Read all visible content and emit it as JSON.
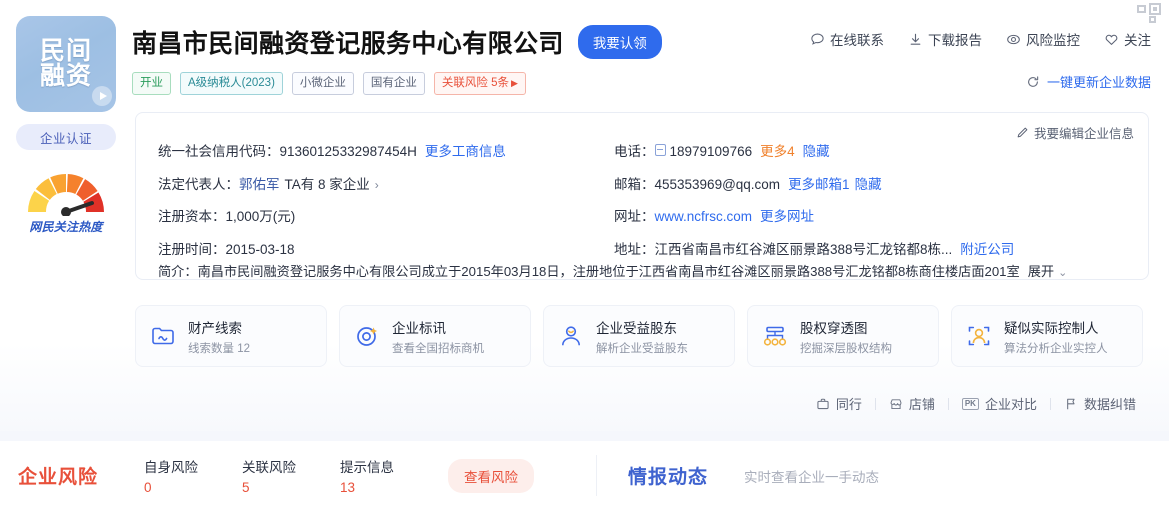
{
  "sidebar": {
    "logo_text_line1": "民间",
    "logo_text_line2": "融资",
    "play_icon": "play-icon",
    "cert_label": "企业认证",
    "gauge_label": "网民关注热度"
  },
  "header": {
    "company_name": "南昌市民间融资登记服务中心有限公司",
    "claim_button": "我要认领",
    "tags": [
      {
        "label": "开业",
        "style": "green"
      },
      {
        "label": "A级纳税人(2023)",
        "style": "teal"
      },
      {
        "label": "小微企业",
        "style": "grey"
      },
      {
        "label": "国有企业",
        "style": "grey"
      },
      {
        "label": "关联风险 5条",
        "style": "red",
        "arrow": "▶"
      }
    ],
    "actions": [
      {
        "label": "在线联系",
        "icon": "chat-icon"
      },
      {
        "label": "下载报告",
        "icon": "download-icon"
      },
      {
        "label": "风险监控",
        "icon": "eye-icon"
      },
      {
        "label": "关注",
        "icon": "heart-icon"
      }
    ],
    "refresh": {
      "label": "一键更新企业数据",
      "icon": "refresh-icon"
    },
    "corner_icon": "qrcode-icon"
  },
  "info": {
    "edit_link": "我要编辑企业信息",
    "edit_icon": "pencil-icon",
    "credit_code": {
      "label": "统一社会信用代码：",
      "value": "91360125332987454H",
      "more_link": "更多工商信息"
    },
    "legal_rep": {
      "label": "法定代表人：",
      "name": "郭佑军",
      "extra": "TA有 8 家企业",
      "chevron": "›"
    },
    "capital": {
      "label": "注册资本：",
      "value": "1,000万(元)"
    },
    "reg_date": {
      "label": "注册时间：",
      "value": "2015-03-18"
    },
    "phone": {
      "label": "电话：",
      "icon": "phone-icon",
      "value": "18979109766",
      "more": "更多4",
      "hide": "隐藏"
    },
    "email": {
      "label": "邮箱：",
      "value": "455353969@qq.com",
      "more": "更多邮箱1",
      "hide": "隐藏"
    },
    "website": {
      "label": "网址：",
      "value": "www.ncfrsc.com",
      "more": "更多网址"
    },
    "address": {
      "label": "地址：",
      "value": "江西省南昌市红谷滩区丽景路388号汇龙铭都8栋...",
      "nearby": "附近公司"
    },
    "brief": {
      "label": "简介：",
      "text": "南昌市民间融资登记服务中心有限公司成立于2015年03月18日，注册地位于江西省南昌市红谷滩区丽景路388号汇龙铭都8栋商住楼店面201室",
      "expand": "展开",
      "expand_icon": "chevron-down-icon"
    }
  },
  "features": [
    {
      "title": "财产线索",
      "sub": "线索数量 12",
      "icon": "property-clue-icon"
    },
    {
      "title": "企业标讯",
      "sub": "查看全国招标商机",
      "icon": "bid-target-icon"
    },
    {
      "title": "企业受益股东",
      "sub": "解析企业受益股东",
      "icon": "beneficiary-person-icon"
    },
    {
      "title": "股权穿透图",
      "sub": "挖掘深层股权结构",
      "icon": "equity-chart-icon"
    },
    {
      "title": "疑似实际控制人",
      "sub": "算法分析企业实控人",
      "icon": "controller-scan-icon"
    }
  ],
  "subbar": [
    {
      "label": "同行",
      "icon": "briefcase-icon"
    },
    {
      "label": "店铺",
      "icon": "shop-icon"
    },
    {
      "label": "企业对比",
      "icon": "pk-icon"
    },
    {
      "label": "数据纠错",
      "icon": "report-error-icon"
    }
  ],
  "risk": {
    "title": "企业风险",
    "stats": [
      {
        "label": "自身风险",
        "value": "0"
      },
      {
        "label": "关联风险",
        "value": "5"
      },
      {
        "label": "提示信息",
        "value": "13"
      }
    ],
    "button": "查看风险"
  },
  "intel": {
    "title": "情报动态",
    "sub": "实时查看企业一手动态"
  },
  "colors": {
    "primary_blue": "#2f6bed",
    "risk_red": "#e8503a",
    "intel_blue": "#3f63cf",
    "orange": "#f0812c"
  }
}
